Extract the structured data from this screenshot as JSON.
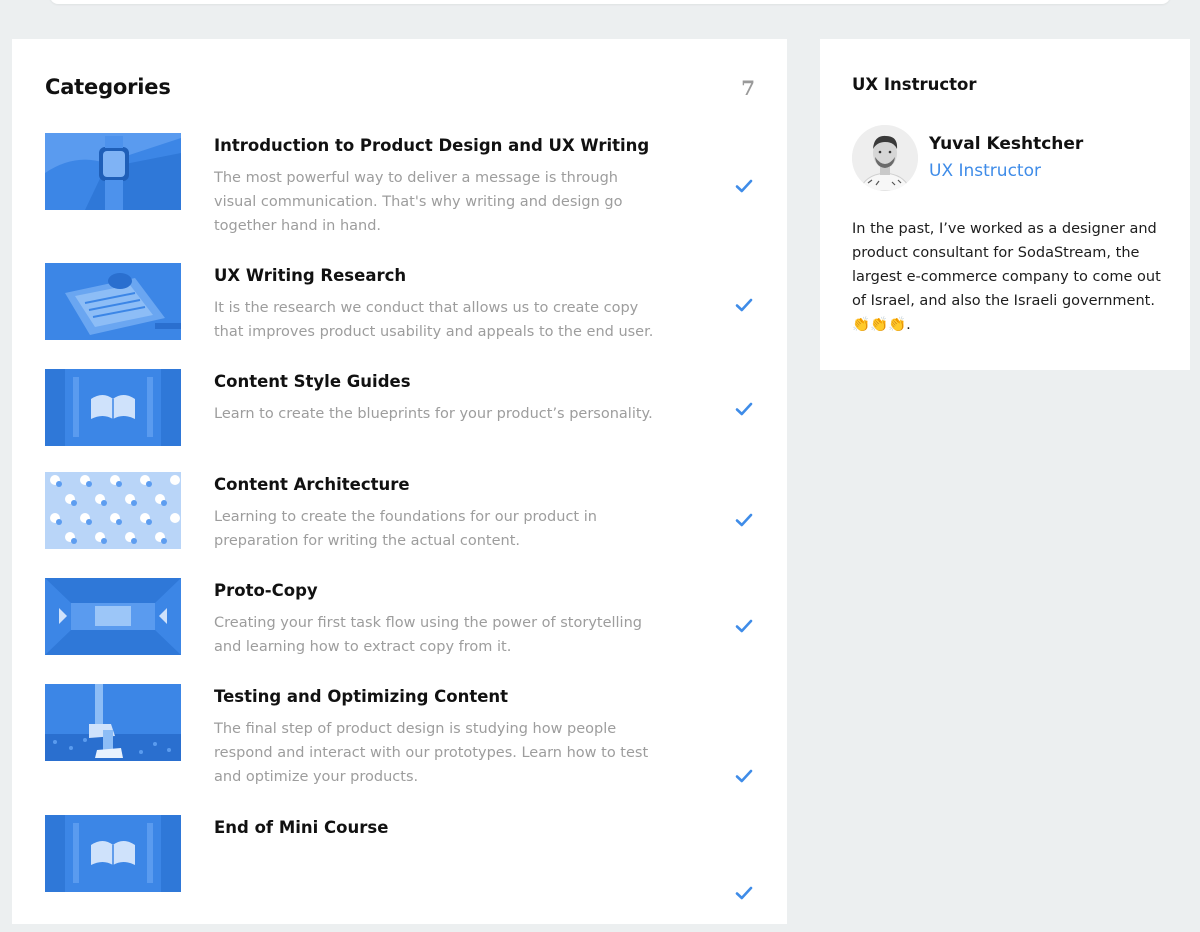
{
  "categories": {
    "title": "Categories",
    "count": "7",
    "items": [
      {
        "title": "Introduction to Product Design and UX Writing",
        "description": "The most powerful way to deliver a message is through visual communication. That's why writing and design go together hand in hand.",
        "completed": true
      },
      {
        "title": "UX Writing Research",
        "description": "It is the research we conduct that allows us to create copy that improves product usability and appeals to the end user.",
        "completed": true
      },
      {
        "title": "Content Style Guides",
        "description": "Learn to create the blueprints for your product’s personality.",
        "completed": true
      },
      {
        "title": "Content Architecture",
        "description": "Learning to create the foundations for our product in preparation for writing the actual content.",
        "completed": true
      },
      {
        "title": "Proto-Copy",
        "description": "Creating your first task flow using the power of storytelling and learning how to extract copy from it.",
        "completed": true
      },
      {
        "title": "Testing and Optimizing Content",
        "description": "The final step of product design is studying how people respond and interact with our prototypes. Learn how to test and optimize your products.",
        "completed": true
      },
      {
        "title": "End of Mini Course",
        "description": "",
        "completed": true
      }
    ]
  },
  "instructor": {
    "heading": "UX Instructor",
    "name": "Yuval Keshtcher",
    "role": "UX Instructor",
    "bio": "In the past, I’ve worked as a designer and product consultant for SodaStream, the largest e-commerce company to come out of Israel, and also the Israeli government. 👏👏👏."
  },
  "colors": {
    "accent": "#3f8ce8",
    "thumbnail_tint": "#3c86e6",
    "page_background": "#eceff0"
  }
}
